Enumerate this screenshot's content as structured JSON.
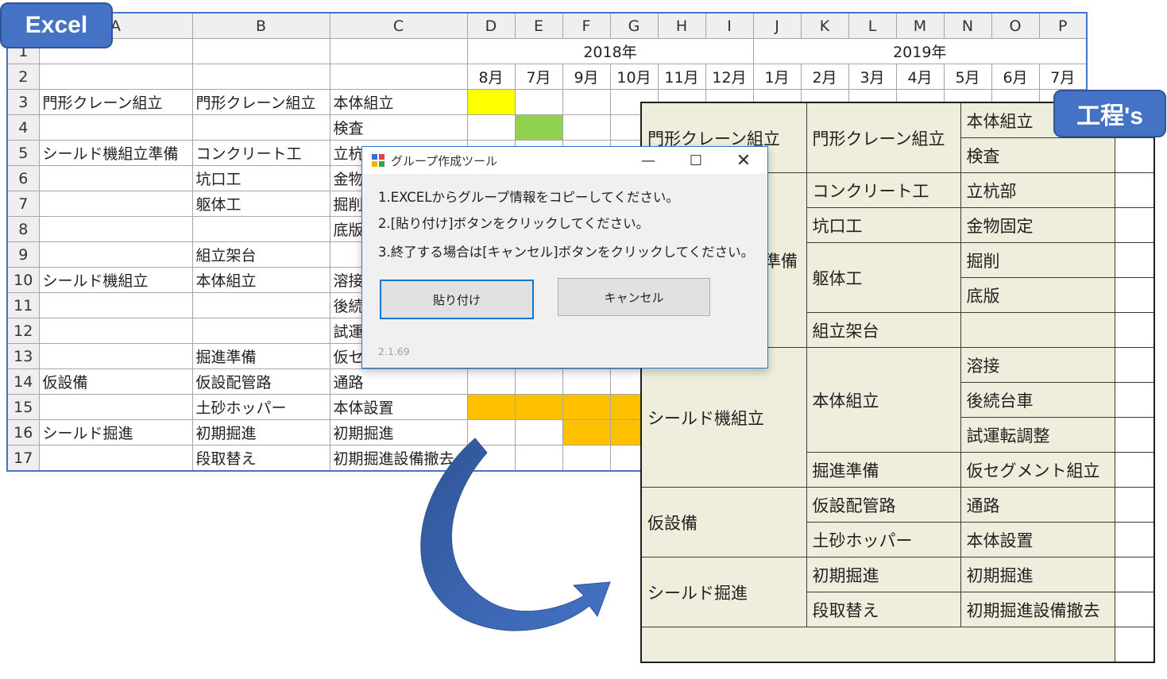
{
  "badges": {
    "excel": "Excel",
    "koutei": "工程's"
  },
  "excel": {
    "col_headers": [
      "A",
      "B",
      "C",
      "D",
      "E",
      "F",
      "G",
      "H",
      "I",
      "J",
      "K",
      "L",
      "M",
      "N",
      "O",
      "P"
    ],
    "years": [
      "2018年",
      "2019年"
    ],
    "months": [
      "8月",
      "7月",
      "9月",
      "10月",
      "11月",
      "12月",
      "1月",
      "2月",
      "3月",
      "4月",
      "5月",
      "6月",
      "7月"
    ],
    "rows": [
      {
        "n": "1",
        "a": "",
        "b": "",
        "c": ""
      },
      {
        "n": "2",
        "a": "",
        "b": "",
        "c": ""
      },
      {
        "n": "3",
        "a": "門形クレーン組立",
        "b": "門形クレーン組立",
        "c": "本体組立"
      },
      {
        "n": "4",
        "a": "",
        "b": "",
        "c": "検査"
      },
      {
        "n": "5",
        "a": "シールド機組立準備",
        "b": "コンクリート工",
        "c": "立杭"
      },
      {
        "n": "6",
        "a": "",
        "b": "坑口工",
        "c": "金物"
      },
      {
        "n": "7",
        "a": "",
        "b": "躯体工",
        "c": "掘削"
      },
      {
        "n": "8",
        "a": "",
        "b": "",
        "c": "底版"
      },
      {
        "n": "9",
        "a": "",
        "b": "組立架台",
        "c": ""
      },
      {
        "n": "10",
        "a": "シールド機組立",
        "b": "本体組立",
        "c": "溶接"
      },
      {
        "n": "11",
        "a": "",
        "b": "",
        "c": "後続"
      },
      {
        "n": "12",
        "a": "",
        "b": "",
        "c": "試運"
      },
      {
        "n": "13",
        "a": "",
        "b": "掘進準備",
        "c": "仮セグメント組立"
      },
      {
        "n": "14",
        "a": "仮設備",
        "b": "仮設配管路",
        "c": "通路"
      },
      {
        "n": "15",
        "a": "",
        "b": "土砂ホッパー",
        "c": "本体設置"
      },
      {
        "n": "16",
        "a": "シールド掘進",
        "b": "初期掘進",
        "c": "初期掘進"
      },
      {
        "n": "17",
        "a": "",
        "b": "段取替え",
        "c": "初期掘進設備撤去"
      }
    ],
    "colors": {
      "yellow": "#ffff00",
      "green": "#92d050",
      "orange": "#ffc000"
    }
  },
  "koutei": {
    "groups": [
      "門形クレーン組立",
      "シールド機組立準備",
      "シールド機組立",
      "仮設備",
      "シールド掘進"
    ],
    "processes": [
      "門形クレーン組立",
      "コンクリート工",
      "坑口工",
      "躯体工",
      "組立架台",
      "本体組立",
      "掘進準備",
      "仮設配管路",
      "土砂ホッパー",
      "初期掘進",
      "段取替え"
    ],
    "tasks": [
      "本体組立",
      "検査",
      "立杭部",
      "金物固定",
      "掘削",
      "底版",
      "溶接",
      "後続台車",
      "試運転調整",
      "仮セグメント組立",
      "通路",
      "本体設置",
      "初期掘進",
      "初期掘進設備撤去"
    ]
  },
  "dialog": {
    "title": "グループ作成ツール",
    "line1": "1.EXCELからグループ情報をコピーしてください。",
    "line2": "2.[貼り付け]ボタンをクリックしてください。",
    "line3": "3.終了する場合は[キャンセル]ボタンをクリックしてください。",
    "paste_label": "貼り付け",
    "cancel_label": "キャンセル",
    "version": "2.1.69",
    "min_glyph": "—",
    "max_glyph": "☐",
    "close_glyph": "✕"
  }
}
